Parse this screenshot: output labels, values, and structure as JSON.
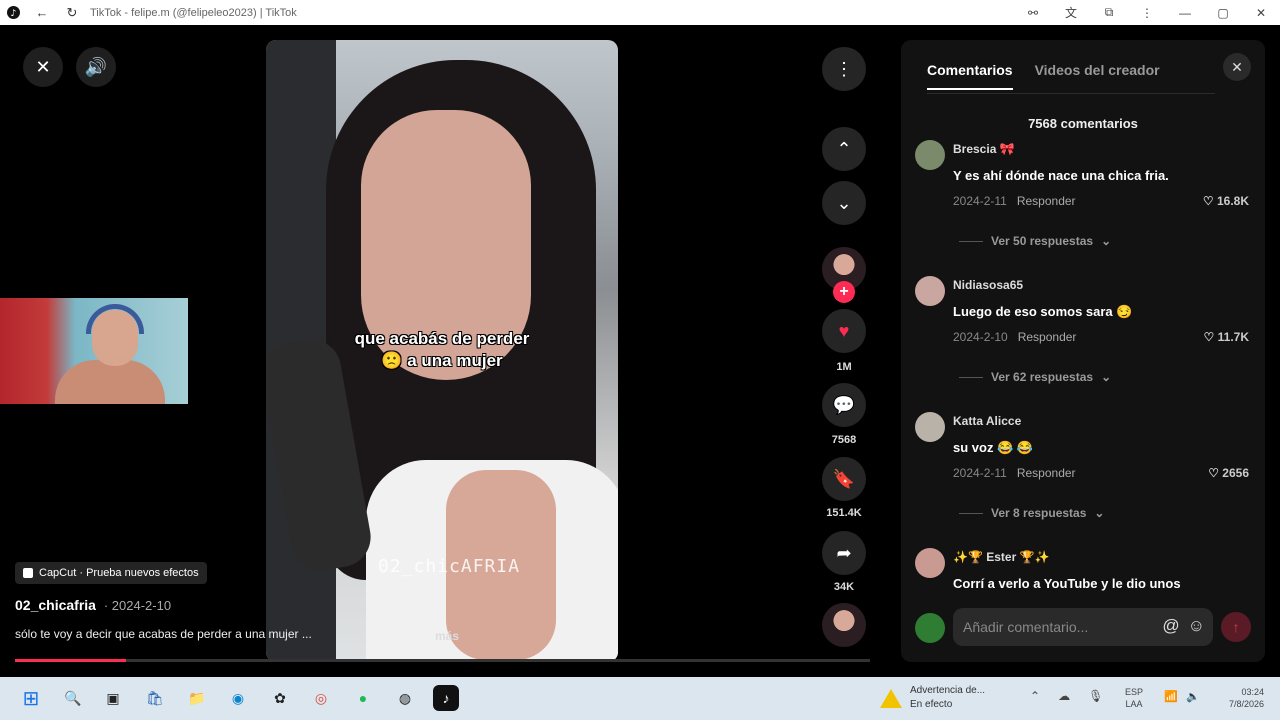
{
  "browser": {
    "title": "TikTok - felipe.m (@felipeleo2023) | TikTok",
    "icons": [
      "tiktok-logo-icon",
      "back-icon",
      "reload-icon"
    ]
  },
  "player": {
    "caption_line1": "que acabás de perder",
    "caption_line2": "🙁 a una mujer",
    "watermark": "02_chicAFRIA",
    "capcut_label": "CapCut · Prueba nuevos efectos",
    "author": "02_chicafria",
    "date": "· 2024-2-10",
    "description": "sólo te voy a decir que acabas de perder a una mujer ...",
    "more_label": "más",
    "progress": 0.13
  },
  "actions": {
    "likes": "1M",
    "comments": "7568",
    "saves": "151.4K",
    "shares": "34K"
  },
  "comments_panel": {
    "tab_comments": "Comentarios",
    "tab_videos": "Videos del creador",
    "count_label": "7568 comentarios",
    "items": [
      {
        "user": "Brescia 🎀",
        "text": "Y es ahí dónde nace una chica fria.",
        "date": "2024-2-11",
        "reply": "Responder",
        "likes": "16.8K",
        "replies": "Ver 50 respuestas"
      },
      {
        "user": "Nidiasosa65",
        "text": "Luego de eso somos sara 😏",
        "date": "2024-2-10",
        "reply": "Responder",
        "likes": "11.7K",
        "replies": "Ver 62 respuestas"
      },
      {
        "user": "Katta Alicce",
        "text": "su voz 😂 😂",
        "date": "2024-2-11",
        "reply": "Responder",
        "likes": "2656",
        "replies": "Ver 8 respuestas"
      },
      {
        "user": "✨🏆 Ester 🏆✨",
        "text": "Corrí a verlo a YouTube y le dio unos"
      }
    ],
    "input_placeholder": "Añadir comentario..."
  },
  "taskbar": {
    "warning_title": "Advertencia de...",
    "warning_sub": "En efecto",
    "lang_line1": "ESP",
    "lang_line2": "LAA",
    "time": "03:24",
    "date": "7/8/2026"
  },
  "colors": {
    "accent": "#fe2c55",
    "panel": "#121212"
  }
}
